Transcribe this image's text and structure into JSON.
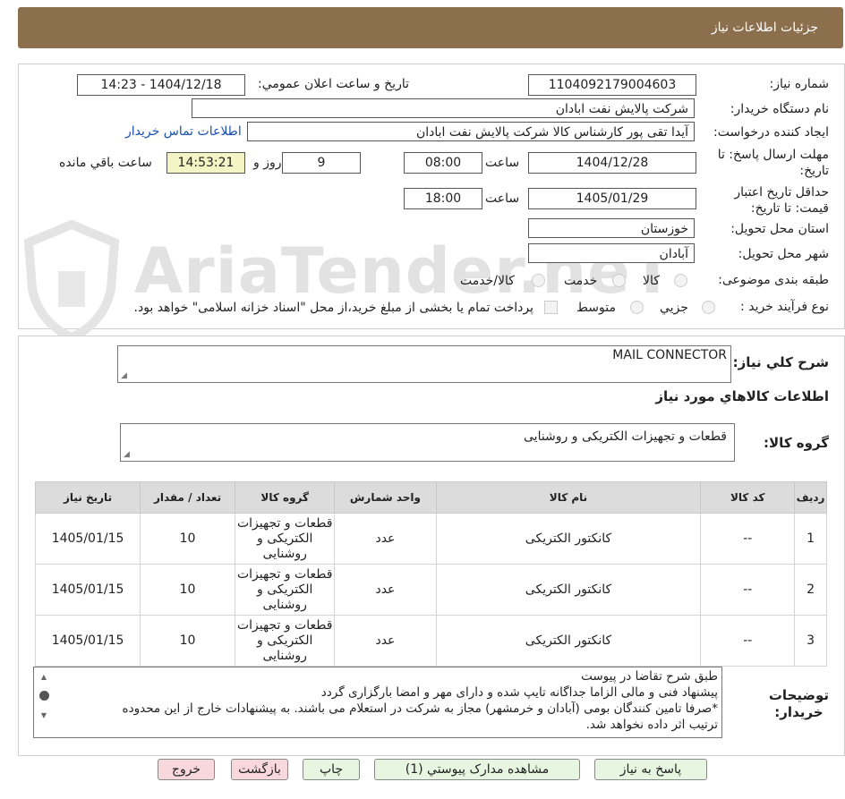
{
  "header": {
    "title": "جزئیات اطلاعات نیاز"
  },
  "watermark": {
    "text": "AriaTender.neT"
  },
  "form": {
    "need_number_label": "شماره نیاز:",
    "need_number": "1104092179004603",
    "announce_label": "تاریخ و ساعت اعلان عمومي:",
    "announce_value": "1404/12/18 - 14:23",
    "buyer_org_label": "نام دستگاه خریدار:",
    "buyer_org": "شرکت پالایش نفت ابادان",
    "creator_label": "ایجاد کننده درخواست:",
    "creator": "آیدا تقی پور کارشناس کالا شرکت پالایش نفت ابادان",
    "contact_link": "اطلاعات تماس خریدار",
    "deadline_label_line1": "مهلت ارسال پاسخ: تا",
    "deadline_label_line2": "تاریخ:",
    "deadline_date": "1404/12/28",
    "time_label": "ساعت",
    "deadline_time": "08:00",
    "days_value": "9",
    "days_label": "روز و",
    "remaining_time": "14:53:21",
    "remaining_label": "ساعت باقي مانده",
    "validity_label_line1": "حداقل تاریخ اعتبار",
    "validity_label_line2": "قیمت: تا تاریخ:",
    "validity_date": "1405/01/29",
    "validity_time": "18:00",
    "province_label": "استان محل تحویل:",
    "province": "خوزستان",
    "city_label": "شهر محل تحویل:",
    "city": "آبادان",
    "category_label": "طبقه بندی موضوعی:",
    "category_options": [
      "کالا",
      "خدمت",
      "کالا/خدمت"
    ],
    "process_label": "نوع فرآیند خرید :",
    "process_options": [
      "جزيي",
      "متوسط"
    ],
    "treasury_note": "پرداخت تمام یا بخشی از مبلغ خرید،از محل \"اسناد خزانه اسلامی\" خواهد بود."
  },
  "details": {
    "summary_label": "شرح کلي نیاز:",
    "summary_value": "MAIL CONNECTOR",
    "goods_info_title": "اطلاعات کالاهاي مورد نیاز",
    "goods_group_label": "گروه کالا:",
    "goods_group_value": "قطعات و تجهیزات الکتریکی و روشنایی",
    "table": {
      "headers": [
        "ردیف",
        "کد کالا",
        "نام کالا",
        "واحد شمارش",
        "گروه کالا",
        "تعداد / مقدار",
        "تاریخ نیاز"
      ],
      "rows": [
        [
          "1",
          "--",
          "کانکتور الکتریکی",
          "عدد",
          "قطعات و تجهیزات الکتریکی و روشنایی",
          "10",
          "1405/01/15"
        ],
        [
          "2",
          "--",
          "کانکتور الکتریکی",
          "عدد",
          "قطعات و تجهیزات الکتریکی و روشنایی",
          "10",
          "1405/01/15"
        ],
        [
          "3",
          "--",
          "کانکتور الکتریکی",
          "عدد",
          "قطعات و تجهیزات الکتریکی و روشنایی",
          "10",
          "1405/01/15"
        ]
      ]
    },
    "notes_label_line1": "توضیحات",
    "notes_label_line2": "خریدار:",
    "notes_lines": [
      "طبق شرح تقاضا در پیوست",
      "پیشنهاد فنی و مالی الزاما جداگانه تایپ شده و دارای مهر و امضا بارگزاری گردد",
      "*صرفا تامین کنندگان بومی (آبادان و خرمشهر) مجاز به شرکت در استعلام می باشند. به پیشنهادات خارج از این محدوده",
      "ترتیب اثر داده نخواهد شد."
    ]
  },
  "buttons": {
    "reply": "پاسخ به نیاز",
    "attachments": "مشاهده مدارک پیوستي (1)",
    "print": "چاپ",
    "back": "بازگشت",
    "exit": "خروج"
  }
}
